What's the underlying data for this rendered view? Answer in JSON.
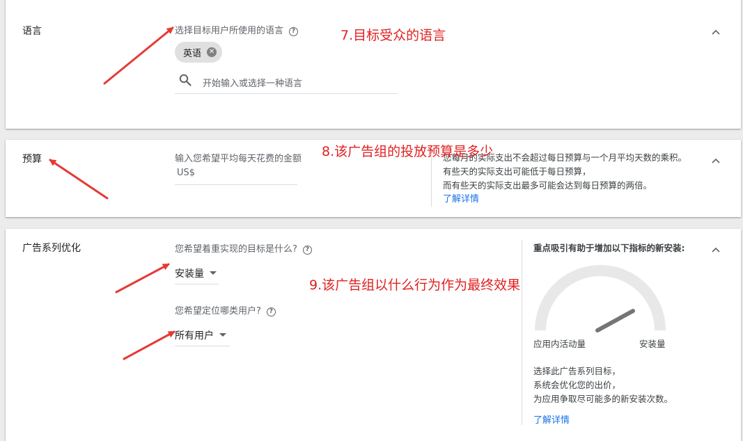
{
  "language": {
    "title": "语言",
    "prompt": "选择目标用户所使用的语言",
    "selected_chip": "英语",
    "search_placeholder": "开始输入或选择一种语言"
  },
  "budget": {
    "title": "预算",
    "prompt": "输入您希望平均每天花费的金额",
    "currency": "US$",
    "info_line1": "您每月的实际支出不会超过每日预算与一个月平均天数的乘积。",
    "info_line2": "有些天的实际支出可能低于每日预算，",
    "info_line3": "而有些天的实际支出最多可能会达到每日预算的两倍。",
    "learn_more": "了解详情"
  },
  "optimization": {
    "title": "广告系列优化",
    "goal_prompt": "您希望着重实现的目标是什么?",
    "goal_value": "安装量",
    "audience_prompt": "您希望定位哪类用户?",
    "audience_value": "所有用户",
    "side_title": "重点吸引有助于增加以下指标的新安装:",
    "gauge_left": "应用内活动量",
    "gauge_right": "安装量",
    "side_line1": "选择此广告系列目标，",
    "side_line2": "系统会优化您的出价，",
    "side_line3": "为应用争取尽可能多的新安装次数。",
    "learn_more": "了解详情"
  },
  "annotations": {
    "a7": "7.目标受众的语言",
    "a8": "8.该广告组的投放预算是多少",
    "a9": "9.该广告组以什么行为作为最终效果"
  },
  "colors": {
    "annotation_red": "#e02020",
    "link_blue": "#1a73e8"
  }
}
